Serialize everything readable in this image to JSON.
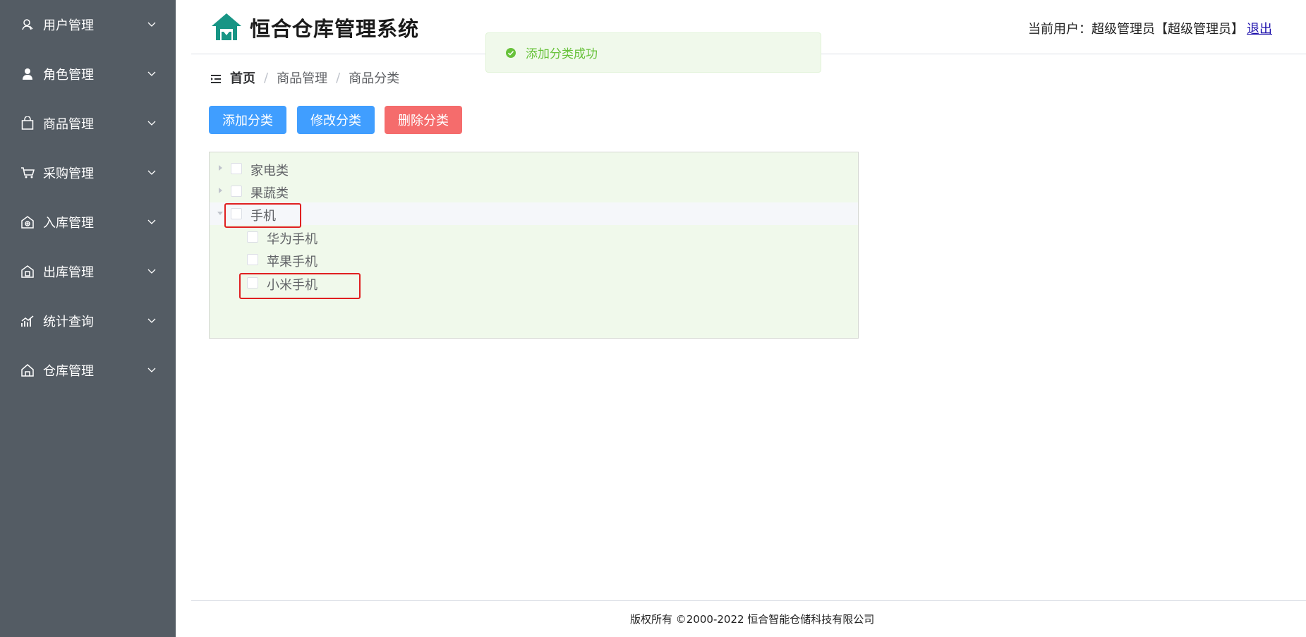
{
  "sidebar": {
    "items": [
      {
        "label": "用户管理",
        "icon": "user-icon"
      },
      {
        "label": "角色管理",
        "icon": "role-icon"
      },
      {
        "label": "商品管理",
        "icon": "bag-icon"
      },
      {
        "label": "采购管理",
        "icon": "cart-icon"
      },
      {
        "label": "入库管理",
        "icon": "stock-in-icon"
      },
      {
        "label": "出库管理",
        "icon": "stock-out-icon"
      },
      {
        "label": "统计查询",
        "icon": "chart-icon"
      },
      {
        "label": "仓库管理",
        "icon": "warehouse-icon"
      }
    ]
  },
  "header": {
    "title": "恒合仓库管理系统",
    "user_info": "当前用户：超级管理员【超级管理员】",
    "logout": "退出"
  },
  "toast": {
    "message": "添加分类成功",
    "icon": "success-check-icon",
    "color": "#67c23a"
  },
  "breadcrumb": {
    "home": "首页",
    "level1": "商品管理",
    "level2": "商品分类",
    "separator": "/"
  },
  "toolbar": {
    "add": "添加分类",
    "edit": "修改分类",
    "delete": "删除分类"
  },
  "tree": {
    "nodes": [
      {
        "label": "家电类",
        "expanded": false,
        "checked": false
      },
      {
        "label": "果蔬类",
        "expanded": false,
        "checked": false
      },
      {
        "label": "手机",
        "expanded": true,
        "checked": false,
        "children": [
          {
            "label": "华为手机",
            "checked": false
          },
          {
            "label": "苹果手机",
            "checked": false
          },
          {
            "label": "小米手机",
            "checked": false
          }
        ]
      }
    ]
  },
  "footer": {
    "copyright": "版权所有 ©2000-2022  恒合智能仓储科技有限公司"
  },
  "colors": {
    "sidebar_bg": "#545c64",
    "primary": "#409eff",
    "danger": "#f56c6c",
    "tree_bg": "#f0f9eb",
    "highlight_box": "#e02020"
  }
}
